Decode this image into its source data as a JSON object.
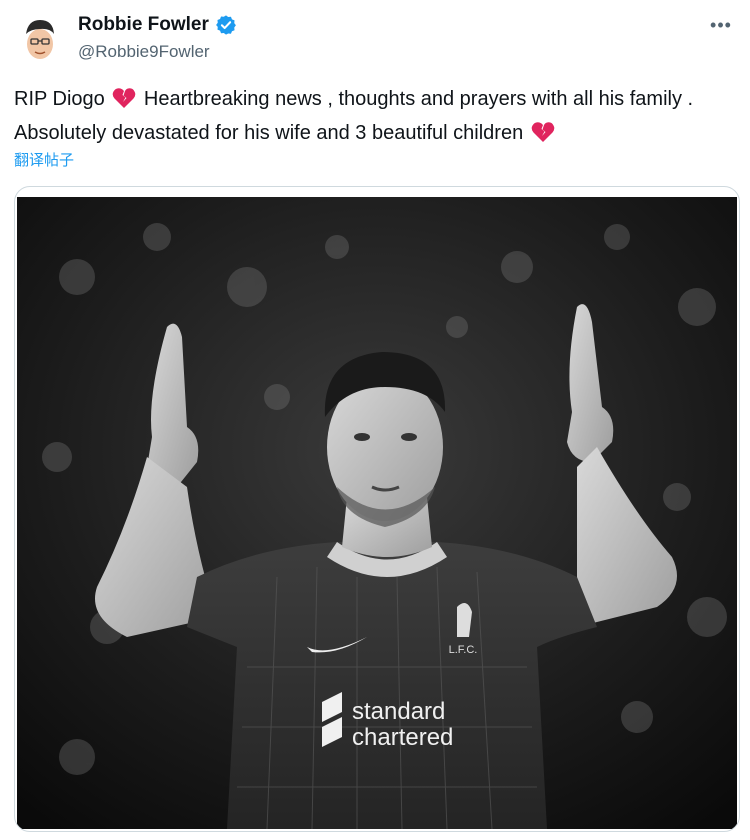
{
  "author": {
    "display_name": "Robbie Fowler",
    "handle": "@Robbie9Fowler",
    "verified": true
  },
  "tweet": {
    "text_part_1": "RIP Diogo",
    "text_part_2": "Heartbreaking news , thoughts and prayers with all his family  . Absolutely devastated for his wife and 3 beautiful children",
    "emoji": "broken-heart-icon"
  },
  "translate_label": "翻译帖子",
  "media": {
    "jersey_sponsor_line1": "standard",
    "jersey_sponsor_line2": "chartered",
    "crest_text": "L.F.C."
  },
  "colors": {
    "link": "#1d9bf0",
    "verified": "#1d9bf0",
    "heart": "#e0245e",
    "secondary_text": "#536471",
    "border": "#cfd9de"
  }
}
